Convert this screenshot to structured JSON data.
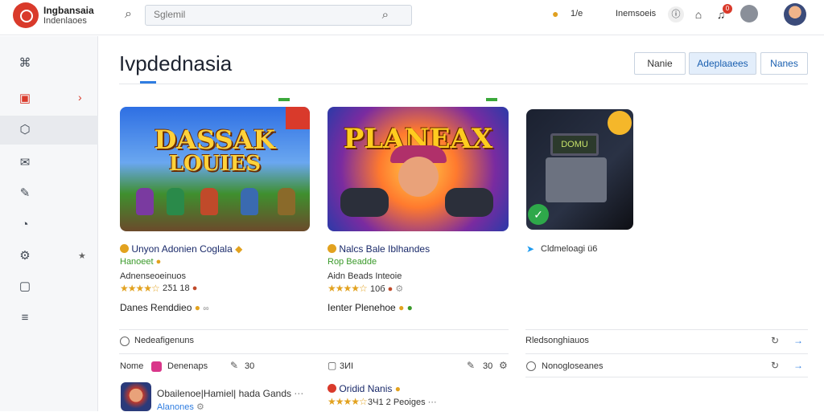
{
  "header": {
    "brand_line1": "Ingbansaia",
    "brand_line2": "Indenlaoes",
    "search_placeholder": "Sglemil",
    "coins_value": "1/e",
    "user_name": "Inemsoeis",
    "notification_count": "0"
  },
  "page": {
    "title": "Ivpdednasia",
    "buttons": [
      "Nanie",
      "Adeplaaees",
      "Nanes"
    ]
  },
  "sidebar": {
    "items": [
      {
        "icon": "grid-icon",
        "glyph": "⌘"
      },
      {
        "icon": "calendar-icon",
        "glyph": "▣",
        "has_chevron": true
      },
      {
        "icon": "box-icon",
        "glyph": "⬡"
      },
      {
        "icon": "mail-icon",
        "glyph": "✉"
      },
      {
        "icon": "edit-icon",
        "glyph": "✎"
      },
      {
        "icon": "pie-icon",
        "glyph": "◔"
      },
      {
        "icon": "settings-icon",
        "glyph": "⚙",
        "has_star": true
      },
      {
        "icon": "image-icon",
        "glyph": "▢"
      },
      {
        "icon": "list-icon",
        "glyph": "≡"
      }
    ]
  },
  "cards": [
    {
      "art_line1": "DASSAK",
      "art_line2": "LOUIES",
      "title": "Unyon Adonien Coglala",
      "subtitle": "Hanoeet",
      "category": "Adnenseoeinuos",
      "rating_num": "2Ƽ1",
      "rating_extra": "18",
      "link": "Danes  Renddieo"
    },
    {
      "art_line1": "PLANEAX",
      "title": "Nalcs Bale Iblhandes",
      "subtitle": "Rop Beadde",
      "category": "Aidn Beads Inteoie",
      "rating_num": "10б",
      "link": "Ienter  Plenehoe"
    },
    {
      "art_screen": "DOMU",
      "title": "Cldmeloagi ü6"
    }
  ],
  "section": {
    "left_header": "Nedeafigenuns",
    "right_header": "Rledsonghiauos",
    "rows": [
      {
        "label": "Nome",
        "label2": "Denenaps",
        "value": "30"
      },
      {
        "label": "3ИI",
        "value": "30"
      },
      {
        "label": "Nonogloseanes"
      }
    ],
    "bottom_item": {
      "title": "Obailenoe|Hamiel| hada Gands",
      "subtitle": "Alanones",
      "second_title": "Oridid Nanis",
      "second_num": "3Ч1",
      "second_extra": "2 Peoiges"
    }
  },
  "colors": {
    "accent": "#2f7de1",
    "brand_red": "#d93a2b",
    "star": "#e2a21f",
    "green": "#3a9a2a"
  }
}
